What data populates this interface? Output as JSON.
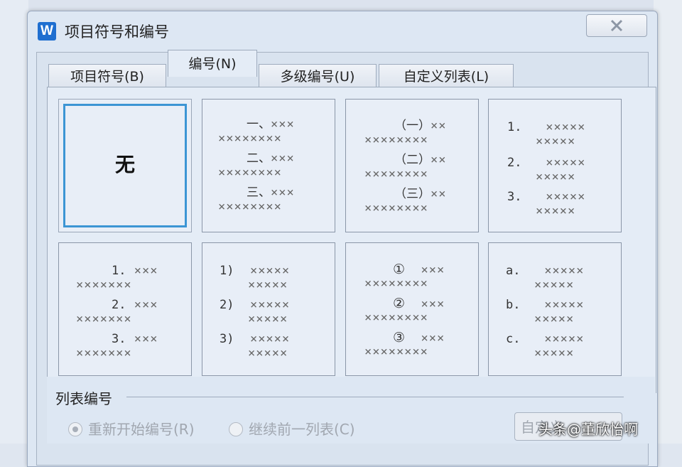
{
  "window": {
    "title": "项目符号和编号",
    "app_icon": "W"
  },
  "tabs": [
    {
      "label": "项目符号(B)"
    },
    {
      "label": "编号(N)"
    },
    {
      "label": "多级编号(U)"
    },
    {
      "label": "自定义列表(L)"
    }
  ],
  "numbering": {
    "none_label": "无",
    "presets": [
      {
        "lines": [
          "一、",
          "二、",
          "三、"
        ]
      },
      {
        "lines": [
          "（一）",
          "（二）",
          "（三）"
        ]
      },
      {
        "lines": [
          "1.",
          "2.",
          "3."
        ]
      },
      {
        "lines": [
          "1.",
          "2.",
          "3."
        ]
      },
      {
        "lines": [
          "1)",
          "2)",
          "3)"
        ]
      },
      {
        "lines": [
          "①",
          "②",
          "③"
        ]
      },
      {
        "lines": [
          "a.",
          "b.",
          "c."
        ]
      }
    ]
  },
  "list_numbering": {
    "label": "列表编号",
    "restart_label": "重新开始编号(R)",
    "continue_label": "继续前一列表(C)",
    "custom_button": "自定义"
  },
  "watermark": "头条@董欣怡啊",
  "colors": {
    "selection": "#3c95d4",
    "app_icon": "#1f6fd0"
  }
}
